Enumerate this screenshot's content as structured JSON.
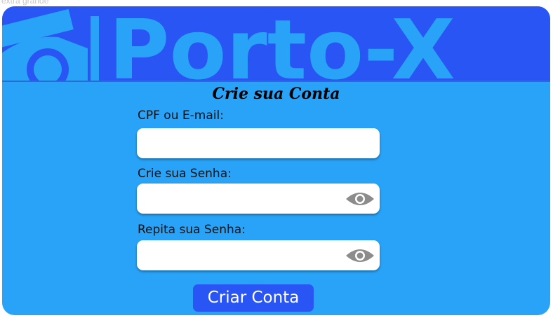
{
  "frame_label": "extra grande",
  "header": {
    "logo_text": "Porto-X"
  },
  "form": {
    "title": "Crie sua Conta",
    "fields": [
      {
        "label": "CPF ou E-mail:",
        "value": "",
        "has_eye": false
      },
      {
        "label": "Crie sua Senha:",
        "value": "",
        "has_eye": true
      },
      {
        "label": "Repita sua Senha:",
        "value": "",
        "has_eye": true
      }
    ],
    "submit_label": "Criar Conta"
  },
  "colors": {
    "banner": "#2855f3",
    "body": "#29a3f7",
    "logo": "#29a3f7",
    "button": "#2855f3",
    "eye_icon": "#8c8c8c"
  },
  "icons": {
    "car": "car-icon",
    "eye": "eye-icon"
  }
}
